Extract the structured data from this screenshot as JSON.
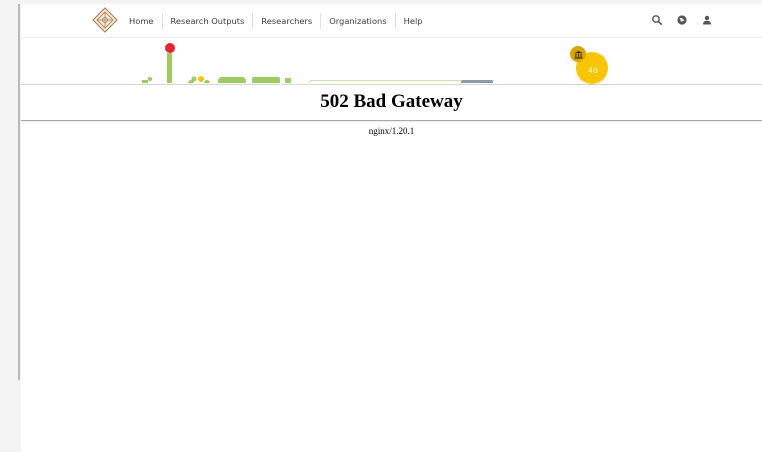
{
  "nav": {
    "items": [
      "Home",
      "Research Outputs",
      "Researchers",
      "Organizations",
      "Help"
    ]
  },
  "nav_icons": [
    "search-icon",
    "globe-icon",
    "user-icon"
  ],
  "institution_badge": {
    "count": "46",
    "icon": "institution-icon",
    "color": "#f8c500"
  },
  "error": {
    "title": "502 Bad Gateway",
    "server": "nginx/1.20.1"
  }
}
